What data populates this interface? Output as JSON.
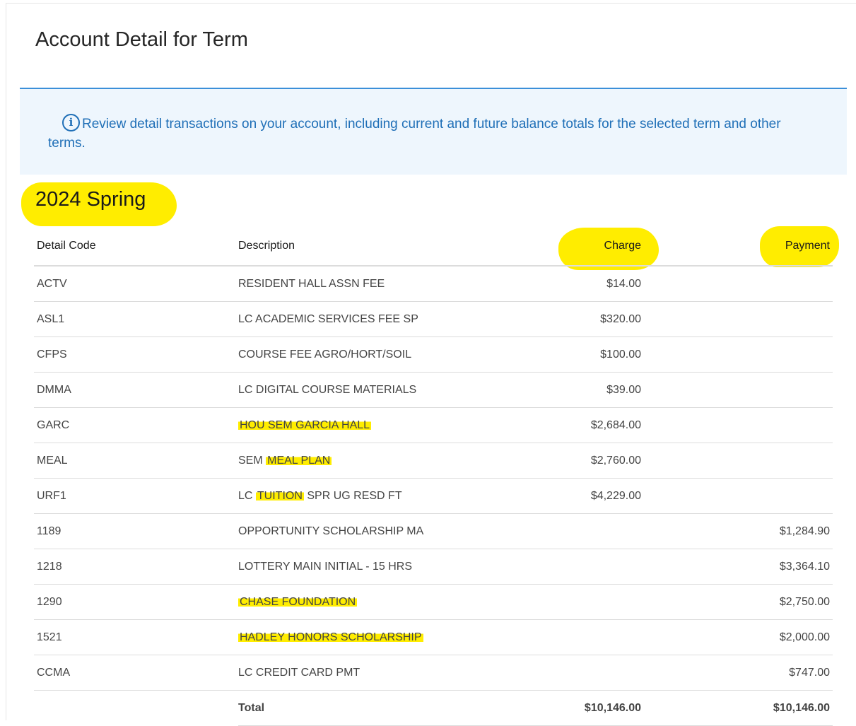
{
  "page": {
    "title": "Account Detail for Term"
  },
  "info": {
    "icon": "info-icon",
    "text": "Review detail transactions on your account, including current and future balance totals for the selected term and other terms."
  },
  "term": {
    "name": "2024 Spring"
  },
  "table": {
    "headers": {
      "code": "Detail Code",
      "description": "Description",
      "charge": "Charge",
      "payment": "Payment"
    },
    "rows": [
      {
        "code": "ACTV",
        "description": "RESIDENT HALL ASSN FEE",
        "charge": "$14.00",
        "payment": ""
      },
      {
        "code": "ASL1",
        "description": "LC ACADEMIC SERVICES FEE SP",
        "charge": "$320.00",
        "payment": ""
      },
      {
        "code": "CFPS",
        "description": "COURSE FEE AGRO/HORT/SOIL",
        "charge": "$100.00",
        "payment": ""
      },
      {
        "code": "DMMA",
        "description": "LC DIGITAL COURSE MATERIALS",
        "charge": "$39.00",
        "payment": ""
      },
      {
        "code": "GARC",
        "description": "HOU SEM GARCIA HALL",
        "charge": "$2,684.00",
        "payment": ""
      },
      {
        "code": "MEAL",
        "description_pre": "SEM ",
        "description_hl": "MEAL PLAN",
        "description_post": "",
        "charge": "$2,760.00",
        "payment": ""
      },
      {
        "code": "URF1",
        "description_pre": "LC ",
        "description_hl": "TUITION",
        "description_post": " SPR UG RESD FT",
        "charge": "$4,229.00",
        "payment": ""
      },
      {
        "code": "1189",
        "description": "OPPORTUNITY SCHOLARSHIP MA",
        "charge": "",
        "payment": "$1,284.90"
      },
      {
        "code": "1218",
        "description": "LOTTERY MAIN INITIAL - 15 HRS",
        "charge": "",
        "payment": "$3,364.10"
      },
      {
        "code": "1290",
        "description": "CHASE FOUNDATION",
        "charge": "",
        "payment": "$2,750.00"
      },
      {
        "code": "1521",
        "description": "HADLEY HONORS SCHOLARSHIP",
        "charge": "",
        "payment": "$2,000.00"
      },
      {
        "code": "CCMA",
        "description": "LC CREDIT CARD PMT",
        "charge": "",
        "payment": "$747.00"
      }
    ],
    "total": {
      "label": "Total",
      "charge": "$10,146.00",
      "payment": "$10,146.00"
    }
  },
  "colors": {
    "highlight": "#ffed00",
    "accent": "#3b8fd9",
    "info_bg": "#eef6fd",
    "info_text": "#1f6fb7"
  }
}
